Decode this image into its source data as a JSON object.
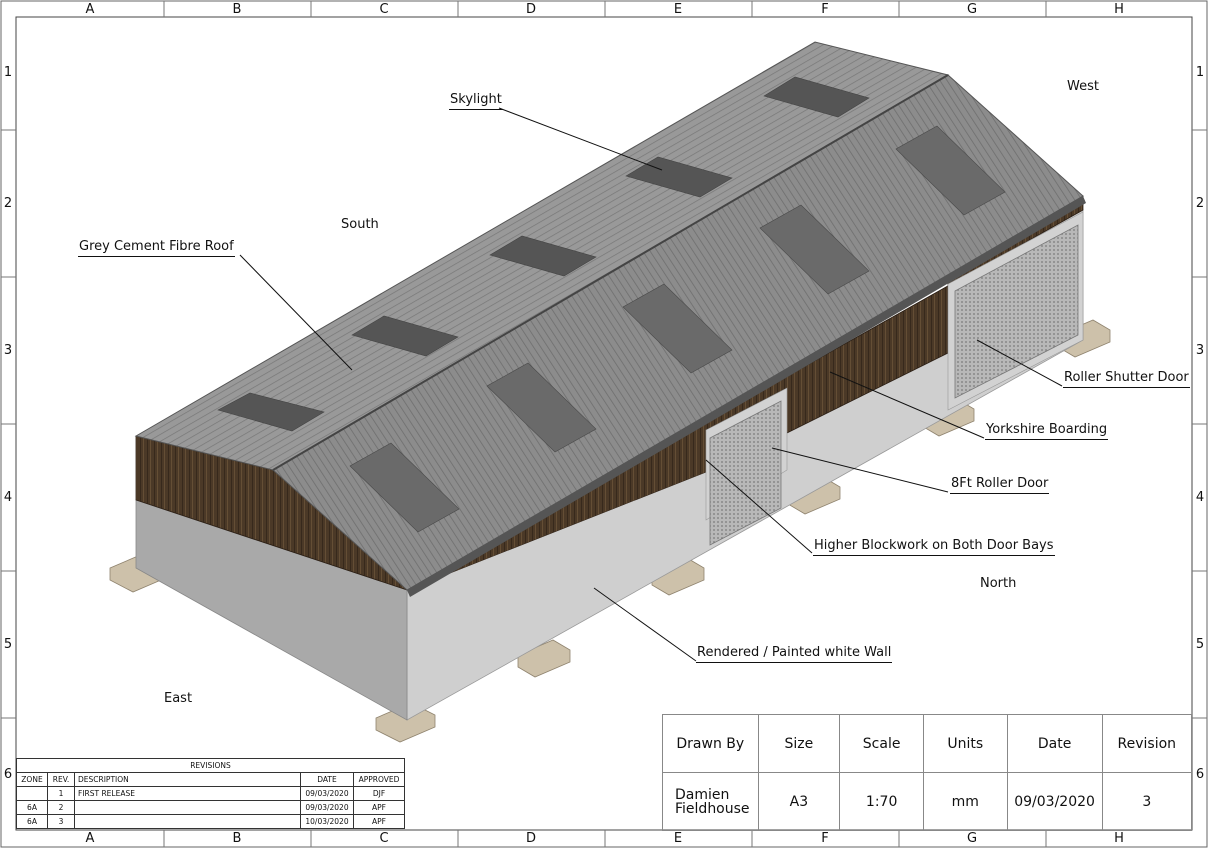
{
  "zones": {
    "columns": [
      "A",
      "B",
      "C",
      "D",
      "E",
      "F",
      "G",
      "H"
    ],
    "rows": [
      "1",
      "2",
      "3",
      "4",
      "5",
      "6"
    ]
  },
  "compass": {
    "west": "West",
    "south": "South",
    "north": "North",
    "east": "East"
  },
  "callouts": {
    "skylight": "Skylight",
    "roof": "Grey Cement Fibre Roof",
    "roller_shutter": "Roller Shutter Door",
    "yorkshire": "Yorkshire Boarding",
    "roller_8ft": "8Ft Roller Door",
    "blockwork": "Higher Blockwork on Both Door Bays",
    "wall": "Rendered / Painted white Wall"
  },
  "revisions": {
    "title": "REVISIONS",
    "headers": [
      "ZONE",
      "REV.",
      "DESCRIPTION",
      "DATE",
      "APPROVED"
    ],
    "rows": [
      {
        "zone": "",
        "rev": "1",
        "description": "FIRST RELEASE",
        "date": "09/03/2020",
        "approved": "DJF"
      },
      {
        "zone": "6A",
        "rev": "2",
        "description": "",
        "date": "09/03/2020",
        "approved": "APF"
      },
      {
        "zone": "6A",
        "rev": "3",
        "description": "",
        "date": "10/03/2020",
        "approved": "APF"
      }
    ]
  },
  "title_block": {
    "headers": {
      "drawn_by": "Drawn By",
      "size": "Size",
      "scale": "Scale",
      "units": "Units",
      "date": "Date",
      "revision": "Revision"
    },
    "values": {
      "drawn_by": "Damien Fieldhouse",
      "size": "A3",
      "scale": "1:70",
      "units": "mm",
      "date": "09/03/2020",
      "revision": "3"
    }
  },
  "colors": {
    "roof": "#8a8a8a",
    "roof_dark": "#5e5e5e",
    "skylight": "#555555",
    "timber": "#4a3826",
    "render": "#cfcfcf",
    "pad": "#cbbfa8"
  }
}
